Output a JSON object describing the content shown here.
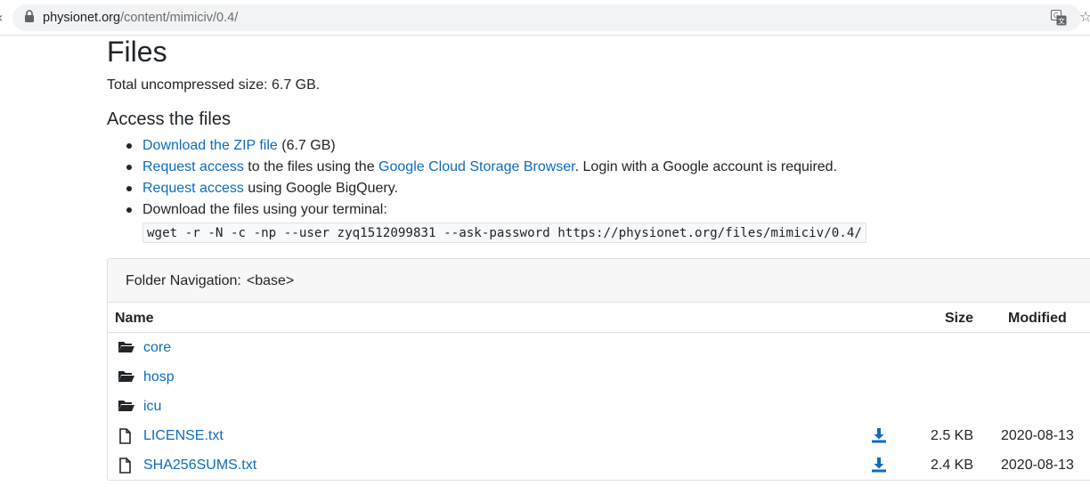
{
  "browser": {
    "url_host": "physionet.org",
    "url_path": "/content/mimiciv/0.4/"
  },
  "page": {
    "title": "Files",
    "total_size": "Total uncompressed size: 6.7 GB.",
    "access_heading": "Access the files",
    "access_items": [
      {
        "link": "Download the ZIP file",
        "text": " (6.7 GB)"
      },
      {
        "link": "Request access",
        "text1": " to the files using the ",
        "link2": "Google Cloud Storage Browser",
        "text2": ". Login with a Google account is required."
      },
      {
        "link": "Request access",
        "text": " using Google BigQuery."
      },
      {
        "text": "Download the files using your terminal:"
      }
    ],
    "terminal_command": "wget -r -N -c -np --user zyq1512099831 --ask-password https://physionet.org/files/mimiciv/0.4/"
  },
  "file_browser": {
    "folder_nav_label": "Folder Navigation:",
    "folder_nav_path": "<base>",
    "columns": {
      "name": "Name",
      "size": "Size",
      "modified": "Modified"
    },
    "rows": [
      {
        "type": "folder",
        "name": "core",
        "size": "",
        "modified": ""
      },
      {
        "type": "folder",
        "name": "hosp",
        "size": "",
        "modified": ""
      },
      {
        "type": "folder",
        "name": "icu",
        "size": "",
        "modified": ""
      },
      {
        "type": "file",
        "name": "LICENSE.txt",
        "size": "2.5 KB",
        "modified": "2020-08-13"
      },
      {
        "type": "file",
        "name": "SHA256SUMS.txt",
        "size": "2.4 KB",
        "modified": "2020-08-13"
      }
    ]
  },
  "colors": {
    "link": "#0d6cbf",
    "text": "#212529",
    "card_header_bg": "#f7f7f7"
  },
  "icons": {
    "folder": "folder-open-icon",
    "file": "file-icon",
    "download": "download-icon",
    "lock": "lock-icon",
    "translate": "translate-icon",
    "bookmark": "star-icon"
  }
}
